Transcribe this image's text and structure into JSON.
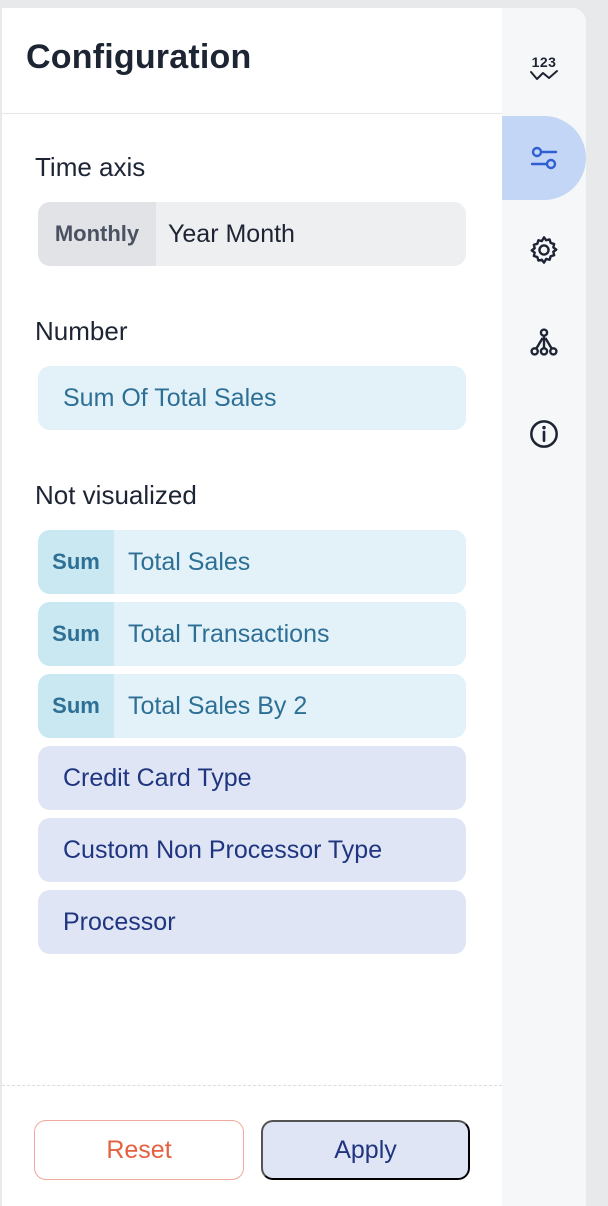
{
  "panel": {
    "title": "Configuration"
  },
  "time_axis": {
    "heading": "Time axis",
    "granularity": "Monthly",
    "field": "Year Month"
  },
  "number": {
    "heading": "Number",
    "field": "Sum Of Total Sales"
  },
  "not_visualized": {
    "heading": "Not visualized",
    "measures": [
      {
        "agg": "Sum",
        "field": "Total Sales"
      },
      {
        "agg": "Sum",
        "field": "Total Transactions"
      },
      {
        "agg": "Sum",
        "field": "Total Sales By 2"
      }
    ],
    "dimensions": [
      {
        "field": "Credit Card Type"
      },
      {
        "field": "Custom Non Processor Type"
      },
      {
        "field": "Processor"
      }
    ]
  },
  "footer": {
    "reset_label": "Reset",
    "apply_label": "Apply"
  },
  "rail": {
    "items": [
      {
        "icon": "number-chart-icon",
        "text": "123",
        "active": false
      },
      {
        "icon": "sliders-icon",
        "active": true
      },
      {
        "icon": "gear-icon",
        "active": false
      },
      {
        "icon": "fork-icon",
        "active": false
      },
      {
        "icon": "info-icon",
        "active": false
      }
    ]
  },
  "colors": {
    "accent_active": "#c3d6f5",
    "measure_bg": "#e2f2f8",
    "dimension_bg": "#dfe5f4",
    "reset_text": "#e5603f"
  }
}
